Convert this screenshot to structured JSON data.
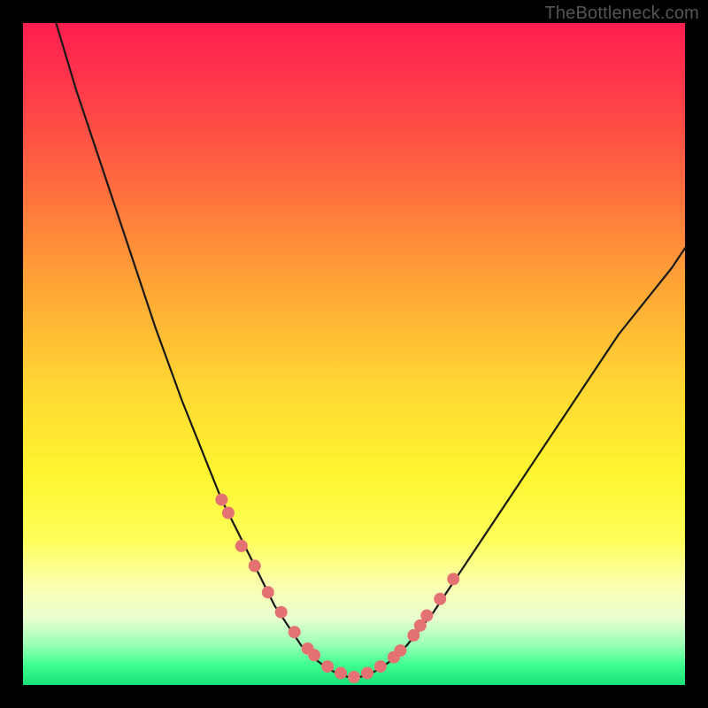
{
  "watermark": "TheBottleneck.com",
  "chart_data": {
    "type": "line",
    "title": "",
    "xlabel": "",
    "ylabel": "",
    "xlim": [
      0,
      100
    ],
    "ylim": [
      0,
      100
    ],
    "curve": {
      "x": [
        5,
        8,
        12,
        16,
        20,
        24,
        28,
        30,
        32,
        34,
        36,
        38,
        40,
        42,
        44,
        46,
        48,
        50,
        52,
        54,
        56,
        58,
        62,
        66,
        70,
        74,
        78,
        82,
        86,
        90,
        94,
        98,
        100
      ],
      "y": [
        100,
        90,
        78,
        66,
        54,
        43,
        33,
        28,
        24,
        20,
        16,
        12,
        9,
        6,
        4,
        2.5,
        1.5,
        1,
        1.5,
        2.5,
        4,
        6,
        11,
        17,
        23,
        29,
        35,
        41,
        47,
        53,
        58,
        63,
        66
      ]
    },
    "dots": {
      "x": [
        30,
        31,
        33,
        35,
        37,
        39,
        41,
        43,
        44,
        46,
        48,
        50,
        52,
        54,
        56,
        57,
        59,
        60,
        61,
        63,
        65
      ],
      "y": [
        28,
        26,
        21,
        18,
        14,
        11,
        8,
        5.5,
        4.5,
        2.8,
        1.8,
        1.2,
        1.8,
        2.8,
        4.2,
        5.2,
        7.5,
        9,
        10.5,
        13,
        16
      ]
    },
    "colors": {
      "curve": "#181818",
      "dots": "#e57272",
      "gradient_top": "#ff1e50",
      "gradient_bottom": "#18e27a"
    }
  }
}
